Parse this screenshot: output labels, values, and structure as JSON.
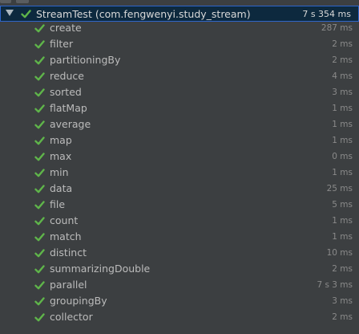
{
  "root": {
    "label": "StreamTest (com.fengwenyi.study_stream)",
    "time": "7 s 354 ms",
    "status": "passed"
  },
  "tests": [
    {
      "label": "create",
      "time": "287 ms"
    },
    {
      "label": "filter",
      "time": "2 ms"
    },
    {
      "label": "partitioningBy",
      "time": "2 ms"
    },
    {
      "label": "reduce",
      "time": "4 ms"
    },
    {
      "label": "sorted",
      "time": "3 ms"
    },
    {
      "label": "flatMap",
      "time": "1 ms"
    },
    {
      "label": "average",
      "time": "1 ms"
    },
    {
      "label": "map",
      "time": "1 ms"
    },
    {
      "label": "max",
      "time": "0 ms"
    },
    {
      "label": "min",
      "time": "1 ms"
    },
    {
      "label": "data",
      "time": "25 ms"
    },
    {
      "label": "file",
      "time": "5 ms"
    },
    {
      "label": "count",
      "time": "1 ms"
    },
    {
      "label": "match",
      "time": "1 ms"
    },
    {
      "label": "distinct",
      "time": "10 ms"
    },
    {
      "label": "summarizingDouble",
      "time": "2 ms"
    },
    {
      "label": "parallel",
      "time": "7 s 3 ms"
    },
    {
      "label": "groupingBy",
      "time": "3 ms"
    },
    {
      "label": "collector",
      "time": "2 ms"
    }
  ],
  "colors": {
    "background": "#3c3f41",
    "selection": "#0d293e",
    "selection_border": "#2f65ca",
    "check": "#5fb54a",
    "text": "#bbbbbb",
    "time": "#8a8a8a"
  },
  "icons": {
    "toggle": "triangle-down-icon",
    "status": "check-icon"
  }
}
